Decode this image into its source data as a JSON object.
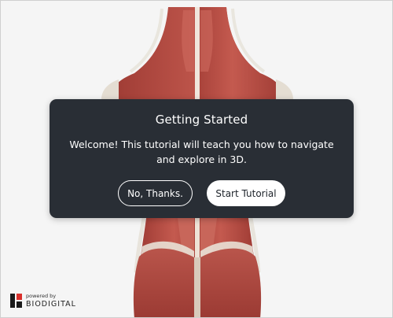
{
  "dialog": {
    "title": "Getting Started",
    "message": "Welcome! This tutorial will teach you how to navigate and explore in 3D.",
    "decline_label": "No, Thanks.",
    "start_label": "Start Tutorial"
  },
  "branding": {
    "powered_by": "powered by",
    "brand": "BIODIGITAL"
  },
  "colors": {
    "dialog_bg": "#1d232a",
    "muscle": "#b5473f",
    "logo_red": "#d9302c"
  }
}
